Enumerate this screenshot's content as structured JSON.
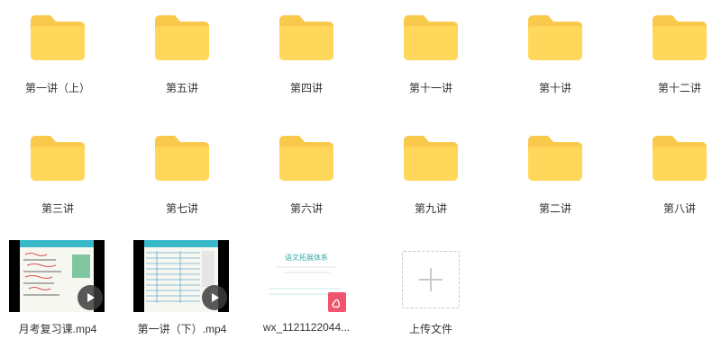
{
  "folders_row1": [
    {
      "label": "第一讲（上）"
    },
    {
      "label": "第五讲"
    },
    {
      "label": "第四讲"
    },
    {
      "label": "第十一讲"
    },
    {
      "label": "第十讲"
    },
    {
      "label": "第十二讲"
    }
  ],
  "folders_row2": [
    {
      "label": "第三讲"
    },
    {
      "label": "第七讲"
    },
    {
      "label": "第六讲"
    },
    {
      "label": "第九讲"
    },
    {
      "label": "第二讲"
    },
    {
      "label": "第八讲"
    }
  ],
  "files": [
    {
      "label": "月考复习课.mp4",
      "type": "video",
      "icon": "play-icon"
    },
    {
      "label": "第一讲（下）.mp4",
      "type": "video",
      "icon": "play-icon"
    },
    {
      "label": "wx_1121122044...",
      "type": "pdf",
      "icon": "pdf-icon",
      "doc_heading": "语文拓展体系"
    }
  ],
  "upload": {
    "label": "上传文件",
    "icon": "plus-icon"
  },
  "colors": {
    "folder_back": "#f8c94a",
    "folder_front": "#ffd75a",
    "pdf": "#f0556b",
    "video_bar": "#39b8c9"
  }
}
